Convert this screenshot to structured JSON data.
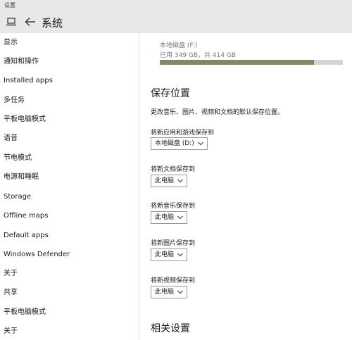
{
  "window": {
    "app_title": "设置"
  },
  "header": {
    "title": "系统"
  },
  "sidebar": {
    "items": [
      {
        "label": "显示"
      },
      {
        "label": "通知和操作"
      },
      {
        "label": "Installed apps"
      },
      {
        "label": "多任务"
      },
      {
        "label": "平板电脑模式"
      },
      {
        "label": "语音"
      },
      {
        "label": "节电模式"
      },
      {
        "label": "电源和睡眠"
      },
      {
        "label": "Storage"
      },
      {
        "label": "Offline maps"
      },
      {
        "label": "Default apps"
      },
      {
        "label": "Windows Defender"
      },
      {
        "label": "关于"
      },
      {
        "label": "共享"
      },
      {
        "label": "平板电脑模式"
      },
      {
        "label": "关于"
      }
    ]
  },
  "storage": {
    "drive_name": "本地磁盘 (F:)",
    "usage_text": "已用 349 GB，共 414 GB",
    "used_fraction": 0.843,
    "bar_color": "#7d8b62",
    "bar_track_color": "#d4d4d4"
  },
  "save_locations": {
    "title": "保存位置",
    "description": "更改音乐、图片、视频和文档的默认保存位置。",
    "fields": [
      {
        "label": "将新应用和游戏保存到",
        "value": "本地磁盘 (D:)"
      },
      {
        "label": "将新文档保存到",
        "value": "此电脑"
      },
      {
        "label": "将新音乐保存到",
        "value": "此电脑"
      },
      {
        "label": "将新图片保存到",
        "value": "此电脑"
      },
      {
        "label": "将新视频保存到",
        "value": "此电脑"
      }
    ]
  },
  "related": {
    "title": "相关设置"
  }
}
